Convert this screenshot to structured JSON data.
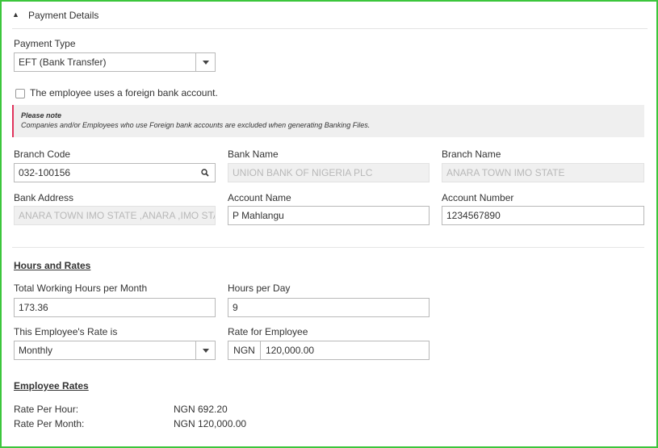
{
  "section": {
    "title": "Payment Details",
    "collapse_icon": "caret-up-icon"
  },
  "payment_type": {
    "label": "Payment Type",
    "value": "EFT (Bank Transfer)"
  },
  "foreign_account": {
    "label": "The employee uses a foreign bank account.",
    "checked": false
  },
  "note": {
    "title": "Please note",
    "body": "Companies and/or Employees who use Foreign bank accounts are excluded when generating Banking Files."
  },
  "bank": {
    "branch_code": {
      "label": "Branch Code",
      "value": "032-100156"
    },
    "bank_name": {
      "label": "Bank Name",
      "value": "UNION BANK OF NIGERIA PLC"
    },
    "branch_name": {
      "label": "Branch Name",
      "value": "ANARA TOWN  IMO STATE"
    },
    "bank_address": {
      "label": "Bank Address",
      "value": "ANARA TOWN IMO STATE  ,ANARA  ,IMO STATE"
    },
    "account_name": {
      "label": "Account Name",
      "value": "P Mahlangu"
    },
    "account_number": {
      "label": "Account Number",
      "value": "1234567890"
    }
  },
  "hours": {
    "title": "Hours and Rates",
    "total_working": {
      "label": "Total Working Hours per Month",
      "value": "173.36"
    },
    "per_day": {
      "label": "Hours per Day",
      "value": "9"
    },
    "rate_is": {
      "label": "This Employee's Rate is",
      "value": "Monthly"
    },
    "rate_for": {
      "label": "Rate for Employee",
      "currency": "NGN",
      "value": "120,000.00"
    }
  },
  "employee_rates": {
    "title": "Employee Rates",
    "rows": [
      {
        "label": "Rate Per Hour:",
        "value": "NGN 692.20"
      },
      {
        "label": "Rate Per Month:",
        "value": "NGN 120,000.00"
      }
    ]
  },
  "colors": {
    "frame": "#3cc63c",
    "note_accent": "#e0335c",
    "note_bg": "#efefef"
  }
}
